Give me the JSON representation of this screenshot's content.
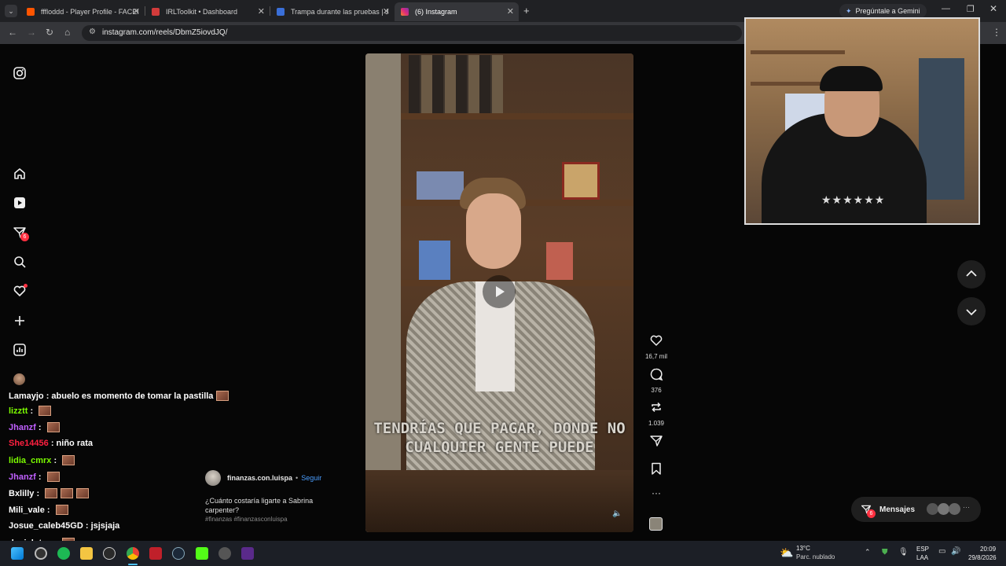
{
  "browser": {
    "tabs": [
      {
        "title": "fffloddd - Player Profile - FACEIT",
        "color": "#ff5500"
      },
      {
        "title": "IRLToolkit • Dashboard",
        "color": "#d23b3b"
      },
      {
        "title": "Trampa durante las pruebas | Ju",
        "color": "#3a6fd8"
      },
      {
        "title": "(6) Instagram",
        "color": "#d6249f"
      }
    ],
    "url": "instagram.com/reels/DbmZ5iovdJQ/",
    "gemini_label": "Pregúntale a Gemini"
  },
  "instagram": {
    "nav_badge": "6",
    "post": {
      "username": "finanzas.con.luispa",
      "follow_label": "Seguir",
      "caption": "¿Cuánto costaría ligarte a Sabrina carpenter?",
      "hashtags": "#finanzas #finanzasconluispa",
      "overlay_line1": "TENDRÍAS QUE PAGAR, DONDE NO",
      "overlay_line2": "CUALQUIER GENTE PUEDE"
    },
    "actions": {
      "likes": "16,7 mil",
      "comments": "376",
      "reposts": "1.039"
    },
    "messages_label": "Mensajes",
    "messages_badge": "6"
  },
  "chat": [
    {
      "user": "Lamayjo",
      "text": "abuelo es momento de tomar la pastilla",
      "color": "#ffffff",
      "emotes": 1
    },
    {
      "user": "lizztt",
      "text": "",
      "color": "#7cfc00",
      "emotes": 1
    },
    {
      "user": "Jhanzf",
      "text": "",
      "color": "#c060ff",
      "emotes": 1
    },
    {
      "user": "She14456",
      "text": "niño rata",
      "color": "#ff2040",
      "emotes": 0
    },
    {
      "user": "lidia_cmrx",
      "text": "",
      "color": "#7cfc00",
      "emotes": 1
    },
    {
      "user": "Jhanzf",
      "text": "",
      "color": "#c060ff",
      "emotes": 1
    },
    {
      "user": "Bxlilly",
      "text": "",
      "color": "#ffffff",
      "emotes": 3
    },
    {
      "user": "Mili_vale",
      "text": "",
      "color": "#ffffff",
      "emotes": 1
    },
    {
      "user": "Josue_caleb45GD",
      "text": "jsjsjaja",
      "color": "#ffffff",
      "emotes": 0
    },
    {
      "user": "danielotaa",
      "text": "",
      "color": "#ffffff",
      "emotes": 1
    }
  ],
  "taskbar": {
    "weather_temp": "13°C",
    "weather_desc": "Parc. nublado",
    "lang1": "ESP",
    "lang2": "LAA",
    "time": "20:09",
    "date": "29/8/2026"
  }
}
